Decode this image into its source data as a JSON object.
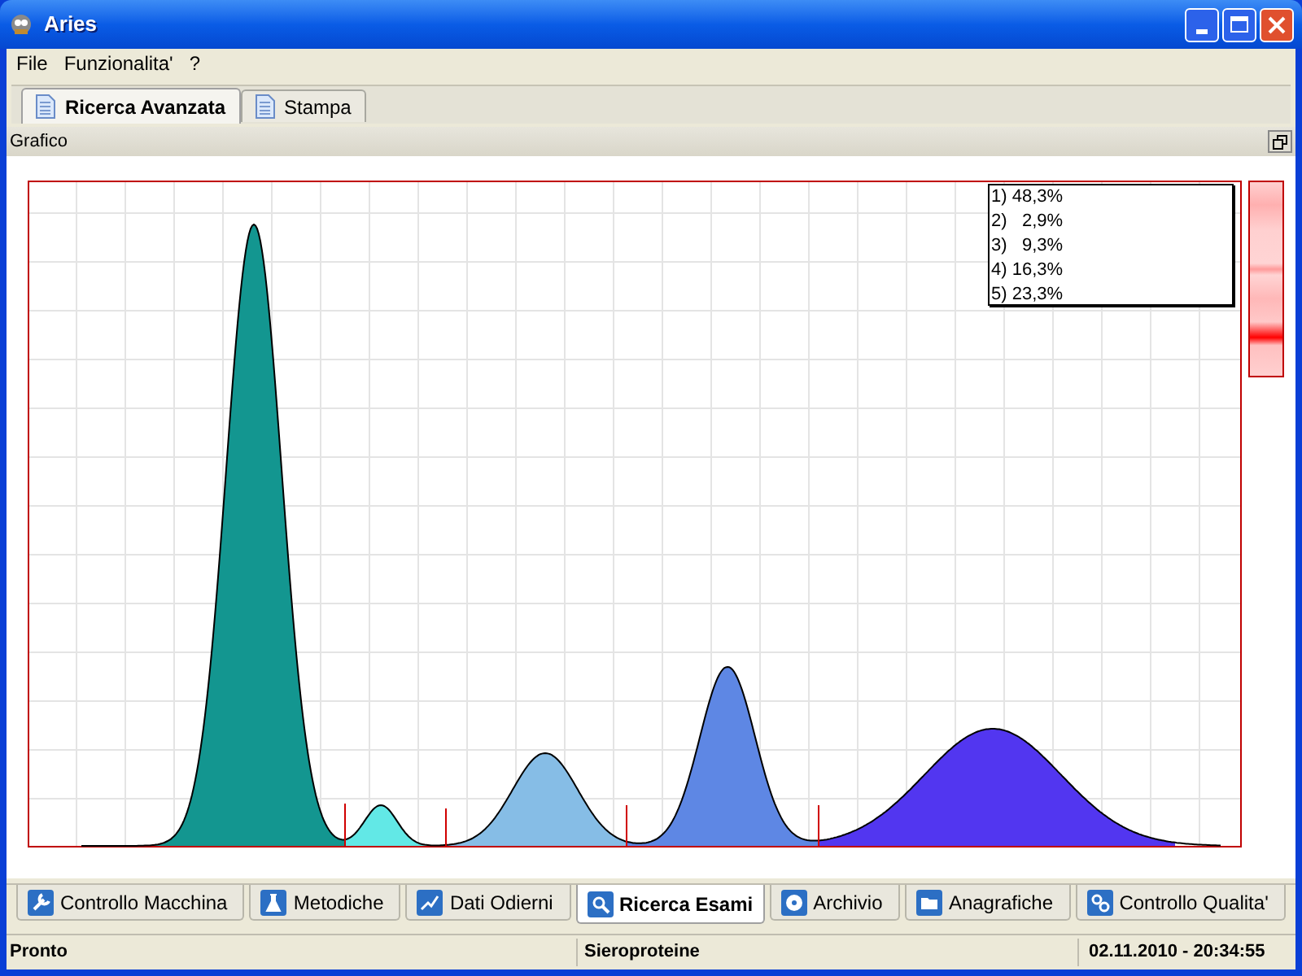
{
  "window": {
    "title": "Aries"
  },
  "menu": [
    "File",
    "Funzionalita'",
    "?"
  ],
  "tabs": [
    {
      "label": "Ricerca Avanzata",
      "selected": true
    },
    {
      "label": "Stampa",
      "selected": false
    }
  ],
  "panel": {
    "title": "Grafico",
    "legend": [
      "1) 48,3%",
      "2)   2,9%",
      "3)   9,3%",
      "4) 16,3%",
      "5) 23,3%"
    ]
  },
  "bottom_tabs": [
    {
      "label": "Controllo Macchina",
      "selected": false
    },
    {
      "label": "Metodiche",
      "selected": false
    },
    {
      "label": "Dati Odierni",
      "selected": false
    },
    {
      "label": "Ricerca Esami",
      "selected": true
    },
    {
      "label": "Archivio",
      "selected": false
    },
    {
      "label": "Anagrafiche",
      "selected": false
    },
    {
      "label": "Controllo Qualita'",
      "selected": false
    }
  ],
  "status_bar": [
    "Pronto",
    "Sieroproteine",
    "02.11.2010 - 20:34:55"
  ]
}
